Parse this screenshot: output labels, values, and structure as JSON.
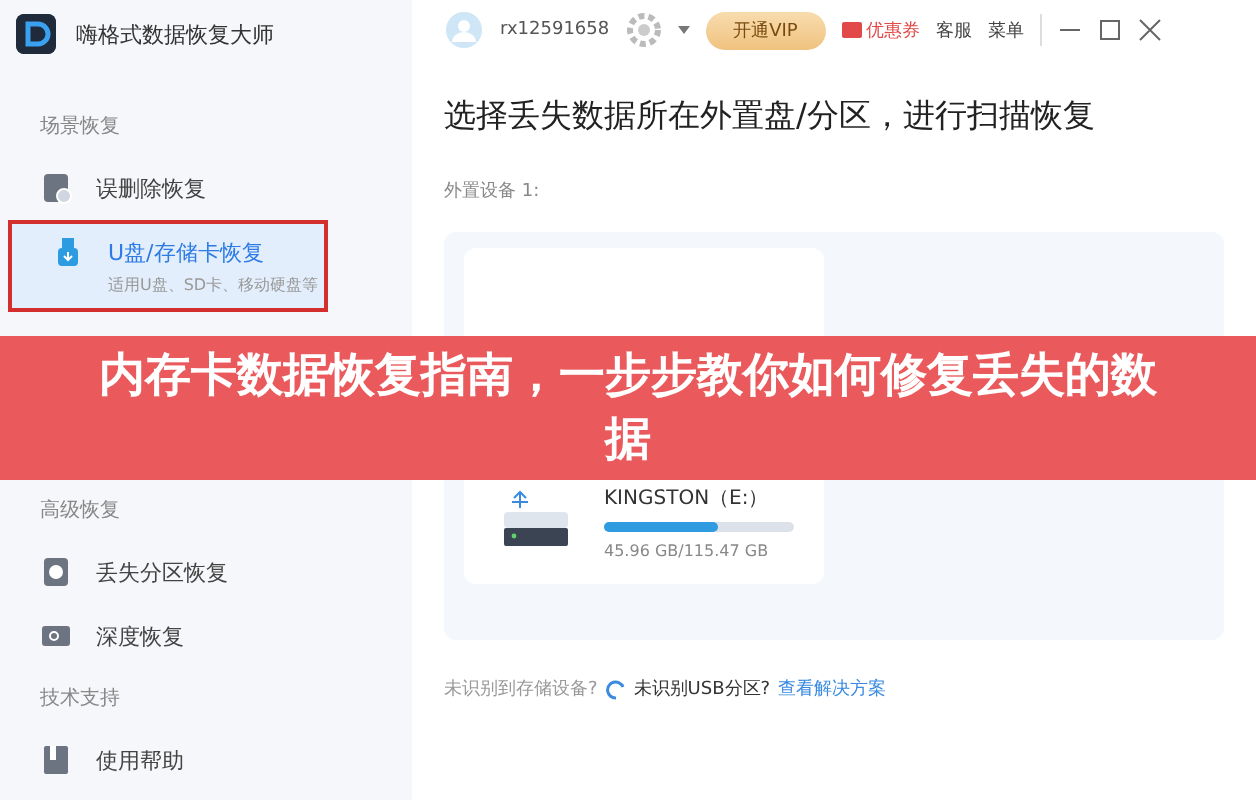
{
  "app": {
    "title": "嗨格式数据恢复大师"
  },
  "sidebar": {
    "sections": [
      {
        "heading": "场景恢复",
        "items": [
          {
            "label": "误删除恢复",
            "selected": false
          },
          {
            "label": "U盘/存储卡恢复",
            "description": "适用U盘、SD卡、移动硬盘等",
            "selected": true
          }
        ]
      },
      {
        "heading": "高级恢复",
        "items": [
          {
            "label": "丢失分区恢复",
            "selected": false
          },
          {
            "label": "深度恢复",
            "selected": false
          }
        ]
      },
      {
        "heading": "技术支持",
        "items": [
          {
            "label": "使用帮助",
            "selected": false
          }
        ]
      }
    ]
  },
  "top_bar": {
    "user": "rx12591658",
    "vip_button": "开通VIP",
    "coupon": "优惠券",
    "links": [
      "客服",
      "菜单"
    ]
  },
  "main": {
    "title": "选择丢失数据所在外置盘/分区，进行扫描恢复",
    "device_group": "外置设备 1:",
    "device": {
      "name": "KINGSTON（E:）",
      "level": 0.6,
      "size": "45.96 GB/115.47 GB"
    },
    "footer": {
      "hint": "未识别到存储设备?",
      "usb_hint": "未识别USB分区?",
      "link": "查看解决方案"
    }
  },
  "banner": {
    "text": "内存卡数据恢复指南，一步步教你如何修复丢失的数据"
  }
}
